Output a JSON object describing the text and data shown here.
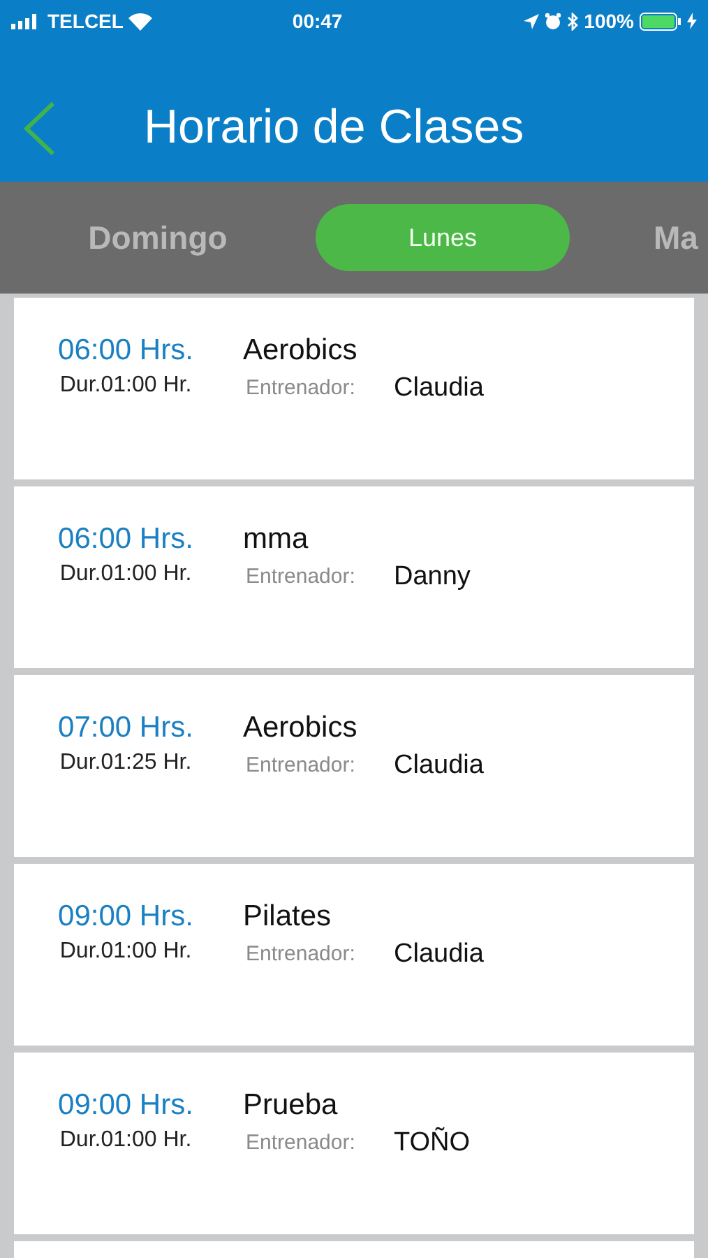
{
  "status_bar": {
    "carrier": "TELCEL",
    "time": "00:47",
    "battery": "100%"
  },
  "header": {
    "title": "Horario de Clases"
  },
  "tabs": [
    {
      "label": "Domingo",
      "selected": false
    },
    {
      "label": "Lunes",
      "selected": true
    },
    {
      "label": "Ma",
      "selected": false
    }
  ],
  "classes": [
    {
      "time": "06:00 Hrs.",
      "duration": "Dur.01:00 Hr.",
      "name": "Aerobics",
      "trainer_label": "Entrenador:",
      "trainer": "Claudia"
    },
    {
      "time": "06:00 Hrs.",
      "duration": "Dur.01:00 Hr.",
      "name": "mma",
      "trainer_label": "Entrenador:",
      "trainer": "Danny"
    },
    {
      "time": "07:00 Hrs.",
      "duration": "Dur.01:25 Hr.",
      "name": "Aerobics",
      "trainer_label": "Entrenador:",
      "trainer": "Claudia"
    },
    {
      "time": "09:00 Hrs.",
      "duration": "Dur.01:00 Hr.",
      "name": "Pilates",
      "trainer_label": "Entrenador:",
      "trainer": "Claudia"
    },
    {
      "time": "09:00 Hrs.",
      "duration": "Dur.01:00 Hr.",
      "name": "Prueba",
      "trainer_label": "Entrenador:",
      "trainer": "TOÑO"
    }
  ]
}
